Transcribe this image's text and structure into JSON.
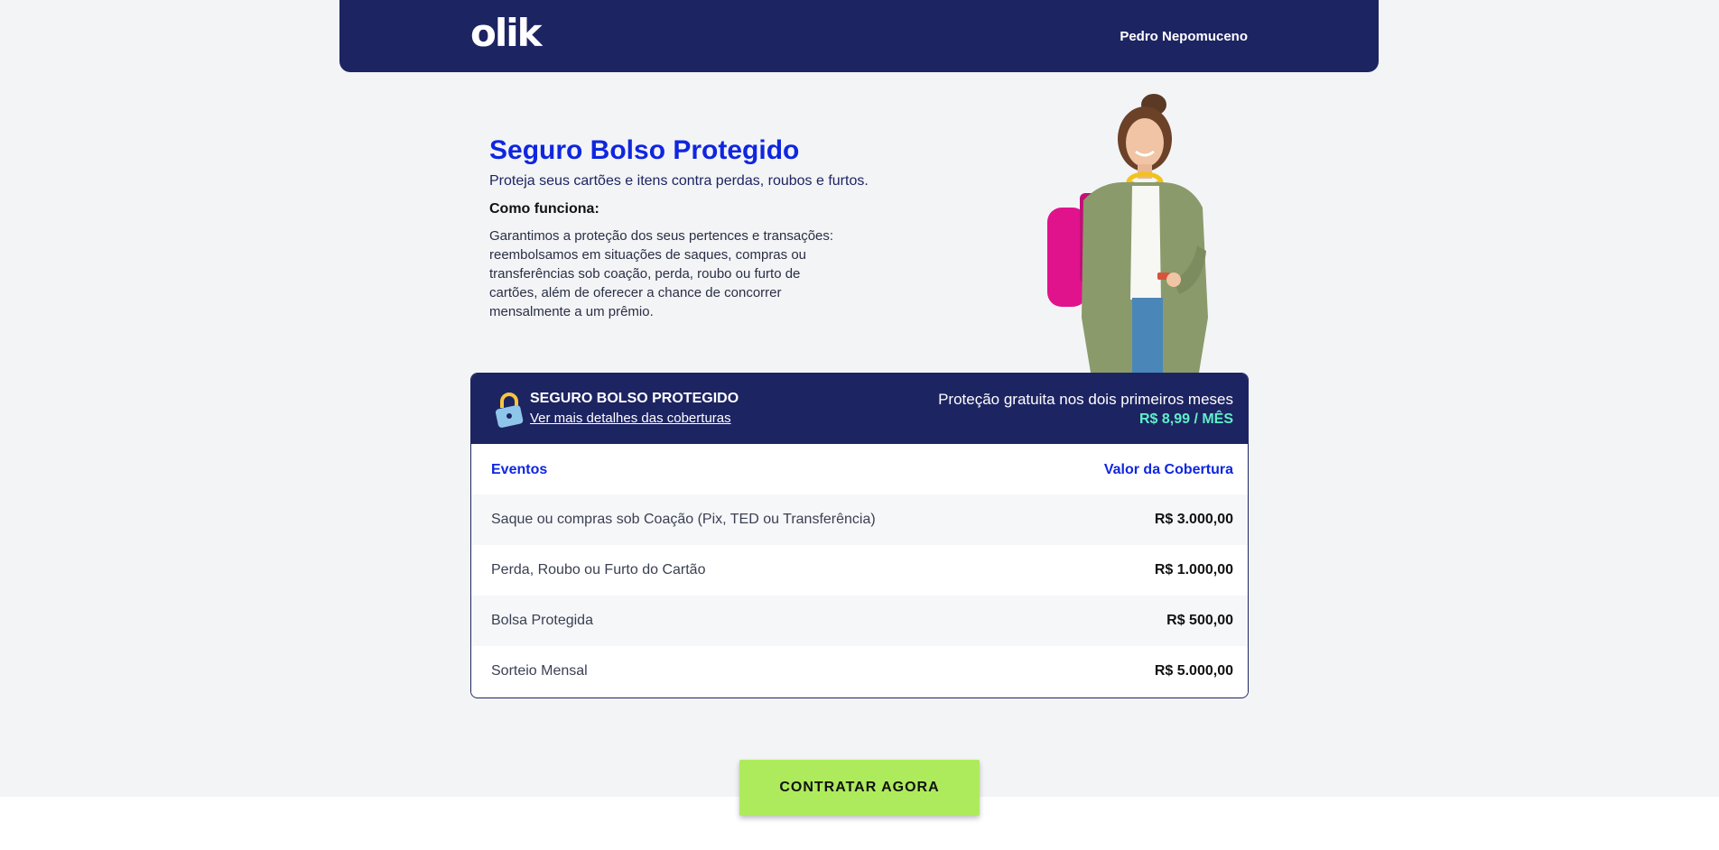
{
  "header": {
    "logo_text": "olik",
    "user_name": "Pedro Nepomuceno"
  },
  "intro": {
    "title": "Seguro Bolso Protegido",
    "subtitle": "Proteja seus cartões e itens contra perdas, roubos e furtos.",
    "how_heading": "Como funciona:",
    "how_text": "Garantimos a proteção dos seus pertences e transações: reembolsamos em situações de saques, compras ou transferências sob coação, perda, roubo ou furto de cartões, além de oferecer a chance de concorrer mensalmente a um prêmio."
  },
  "card": {
    "icon": "lock-icon",
    "title": "SEGURO BOLSO PROTEGIDO",
    "link": "Ver mais detalhes das coberturas",
    "promo": "Proteção gratuita nos dois primeiros meses",
    "price": "R$ 8,99 / MÊS",
    "columns": {
      "events": "Eventos",
      "value": "Valor da Cobertura"
    },
    "rows": [
      {
        "event": "Saque ou compras sob Coação (Pix, TED ou Transferência)",
        "value": "R$ 3.000,00"
      },
      {
        "event": "Perda, Roubo ou Furto do Cartão",
        "value": "R$ 1.000,00"
      },
      {
        "event": "Bolsa Protegida",
        "value": "R$ 500,00"
      },
      {
        "event": "Sorteio Mensal",
        "value": "R$ 5.000,00"
      }
    ]
  },
  "cta": {
    "label": "CONTRATAR AGORA"
  },
  "colors": {
    "navy": "#1d2462",
    "title_blue": "#0f26e0",
    "price_green": "#5ff0c8",
    "cta_green": "#aeeb5c",
    "background": "#f3f4f6"
  }
}
